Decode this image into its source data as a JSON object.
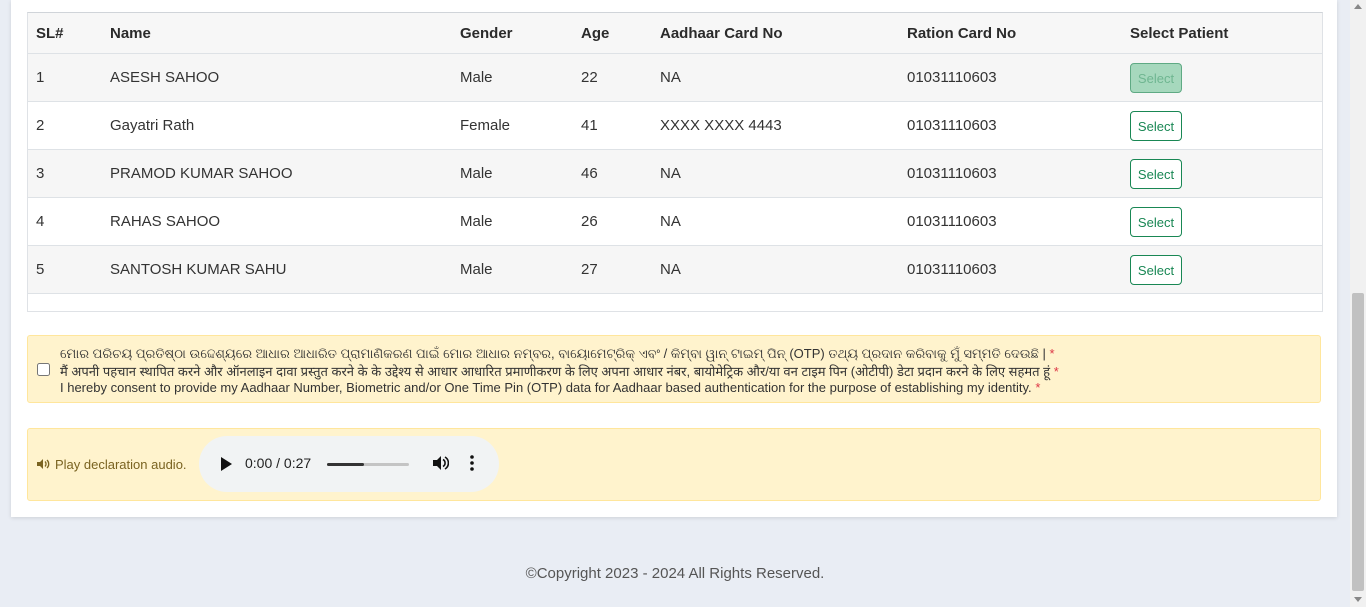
{
  "table": {
    "headers": [
      "SL#",
      "Name",
      "Gender",
      "Age",
      "Aadhaar Card No",
      "Ration Card No",
      "Select Patient"
    ],
    "rows": [
      {
        "sl": "1",
        "name": "ASESH SAHOO",
        "gender": "Male",
        "age": "22",
        "aadhaar": "NA",
        "ration": "01031110603",
        "action": "Select"
      },
      {
        "sl": "2",
        "name": "Gayatri Rath",
        "gender": "Female",
        "age": "41",
        "aadhaar": "XXXX XXXX 4443",
        "ration": "01031110603",
        "action": "Select"
      },
      {
        "sl": "3",
        "name": "PRAMOD KUMAR SAHOO",
        "gender": "Male",
        "age": "46",
        "aadhaar": "NA",
        "ration": "01031110603",
        "action": "Select"
      },
      {
        "sl": "4",
        "name": "RAHAS SAHOO",
        "gender": "Male",
        "age": "26",
        "aadhaar": "NA",
        "ration": "01031110603",
        "action": "Select"
      },
      {
        "sl": "5",
        "name": "SANTOSH KUMAR SAHU",
        "gender": "Male",
        "age": "27",
        "aadhaar": "NA",
        "ration": "01031110603",
        "action": "Select"
      }
    ]
  },
  "consent": {
    "odia": "ମୋର ପରିଚୟ ପ୍ରତିଷ୍ଠା ଉଦ୍ଦେଶ୍ୟରେ ଆଧାର ଆଧାରିତ ପ୍ରାମାଣିକରଣ ପାଇଁ ମୋର ଆଧାର ନମ୍ବର, ବାୟୋମେଟ୍ରିକ୍ ଏବଂ / କିମ୍ବା ୱାନ୍ ଟାଇମ୍ ପିନ୍ (OTP) ତଥ୍ୟ ପ୍ରଦାନ କରିବାକୁ ମୁଁ ସମ୍ମତି ଦେଉଛି |",
    "hindi": "मैं अपनी पहचान स्थापित करने और ऑनलाइन दावा प्रस्तुत करने के के उद्देश्य से आधार आधारित प्रमाणीकरण के लिए अपना आधार नंबर, बायोमेट्रिक और/या वन टाइम पिन (ओटीपी) डेटा प्रदान करने के लिए सहमत हूं",
    "english": "I hereby consent to provide my Aadhaar Number, Biometric and/or One Time Pin (OTP) data for Aadhaar based authentication for the purpose of establishing my identity.",
    "required_mark": "*"
  },
  "audio": {
    "label": "Play declaration audio.",
    "time": "0:00 / 0:27",
    "volume_level": 0.45
  },
  "footer": {
    "copyright": "©Copyright 2023 - 2024 All Rights Reserved."
  },
  "colors": {
    "select_button": "#198754",
    "alert_background": "#fff3cd",
    "required": "#dc3545"
  }
}
